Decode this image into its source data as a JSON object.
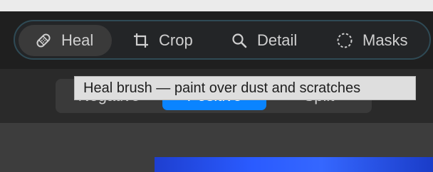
{
  "toolbar": {
    "tools": [
      {
        "label": "Heal",
        "icon": "bandage-icon",
        "active": true
      },
      {
        "label": "Crop",
        "icon": "crop-icon",
        "active": false
      },
      {
        "label": "Detail",
        "icon": "magnifier-icon",
        "active": false
      },
      {
        "label": "Masks",
        "icon": "dashed-circle-icon",
        "active": false
      }
    ]
  },
  "mode_selector": {
    "options": [
      "Negative",
      "Positive",
      "Split"
    ],
    "selected": "Positive"
  },
  "tooltip": {
    "text": "Heal brush — paint over dust and scratches"
  },
  "colors": {
    "accent": "#0a84ff",
    "toolbar_border": "#2f4a55"
  }
}
